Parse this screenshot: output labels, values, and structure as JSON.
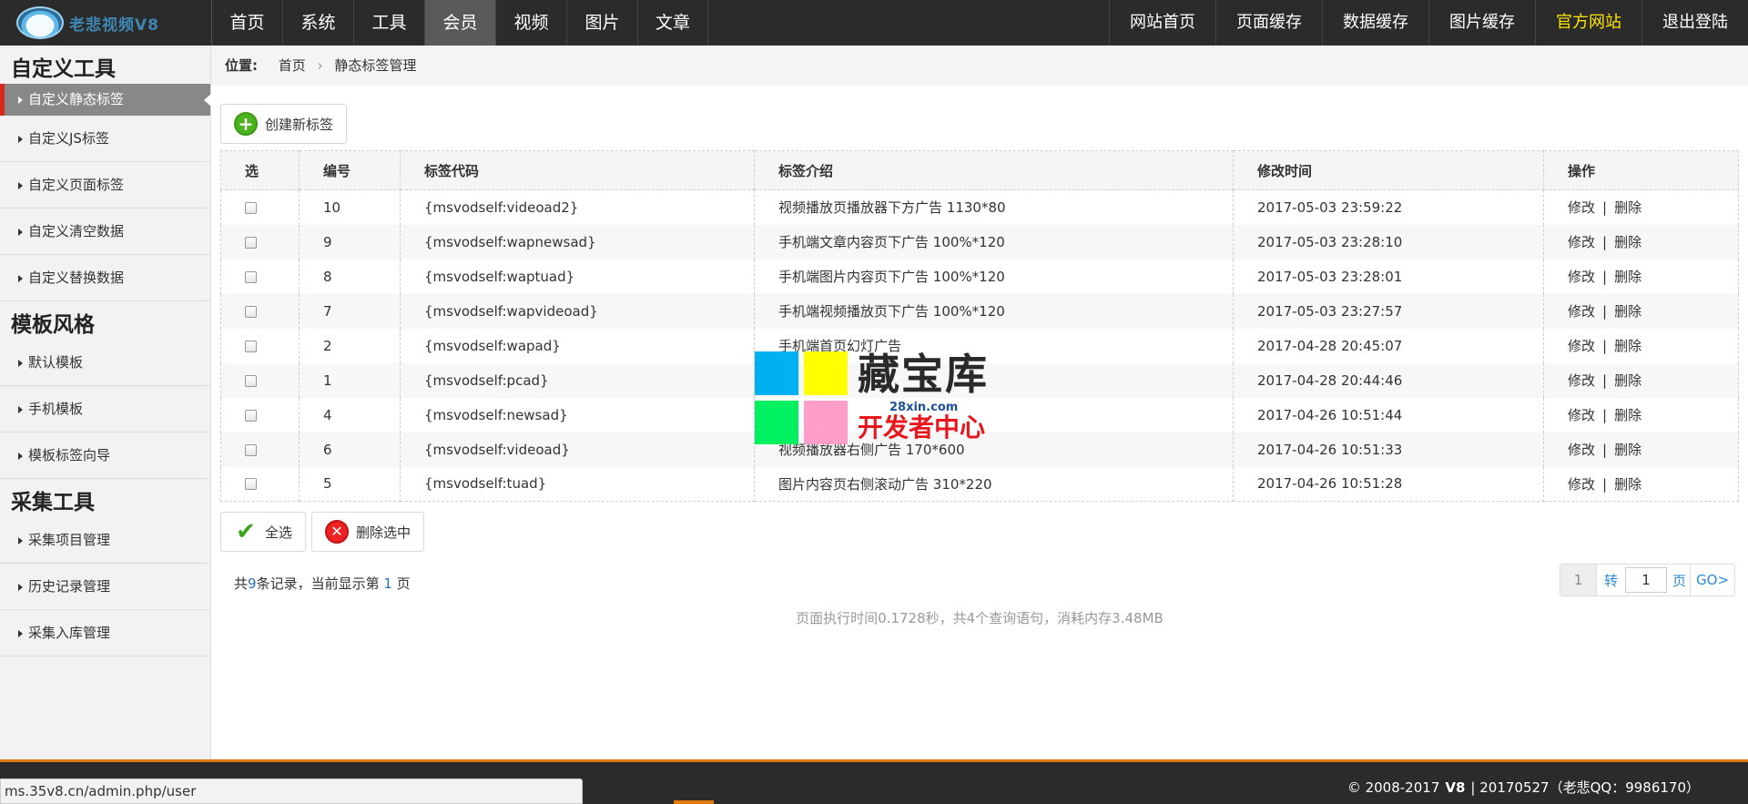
{
  "app": {
    "logo_text": "老悲视频V8"
  },
  "topnav": {
    "left": [
      {
        "label": "首页",
        "active": false
      },
      {
        "label": "系统",
        "active": false
      },
      {
        "label": "工具",
        "active": false
      },
      {
        "label": "会员",
        "active": true
      },
      {
        "label": "视频",
        "active": false
      },
      {
        "label": "图片",
        "active": false
      },
      {
        "label": "文章",
        "active": false
      }
    ],
    "right": [
      {
        "label": "网站首页"
      },
      {
        "label": "页面缓存"
      },
      {
        "label": "数据缓存"
      },
      {
        "label": "图片缓存"
      },
      {
        "label": "官方网站",
        "highlight": true
      },
      {
        "label": "退出登陆"
      }
    ]
  },
  "sidebar": {
    "groups": [
      {
        "title": "自定义工具",
        "items": [
          {
            "label": "自定义静态标签",
            "active": true
          },
          {
            "label": "自定义JS标签"
          },
          {
            "label": "自定义页面标签"
          },
          {
            "label": "自定义清空数据"
          },
          {
            "label": "自定义替换数据"
          }
        ]
      },
      {
        "title": "模板风格",
        "items": [
          {
            "label": "默认模板"
          },
          {
            "label": "手机模板"
          },
          {
            "label": "模板标签向导"
          }
        ]
      },
      {
        "title": "采集工具",
        "items": [
          {
            "label": "采集项目管理"
          },
          {
            "label": "历史记录管理"
          },
          {
            "label": "采集入库管理"
          }
        ]
      }
    ]
  },
  "breadcrumb": {
    "label": "位置:",
    "home": "首页",
    "sep": "›",
    "current": "静态标签管理"
  },
  "buttons": {
    "create": "创建新标签",
    "select_all": "全选",
    "delete_selected": "删除选中"
  },
  "table": {
    "headers": [
      "选",
      "编号",
      "标签代码",
      "标签介绍",
      "修改时间",
      "操作"
    ],
    "op_edit": "修改",
    "op_sep": "|",
    "op_delete": "删除",
    "rows": [
      {
        "id": "10",
        "code": "{msvodself:videoad2}",
        "desc": "视频播放页播放器下方广告 1130*80",
        "time": "2017-05-03 23:59:22"
      },
      {
        "id": "9",
        "code": "{msvodself:wapnewsad}",
        "desc": "手机端文章内容页下广告 100%*120",
        "time": "2017-05-03 23:28:10"
      },
      {
        "id": "8",
        "code": "{msvodself:waptuad}",
        "desc": "手机端图片内容页下广告 100%*120",
        "time": "2017-05-03 23:28:01"
      },
      {
        "id": "7",
        "code": "{msvodself:wapvideoad}",
        "desc": "手机端视频播放页下广告 100%*120",
        "time": "2017-05-03 23:27:57"
      },
      {
        "id": "2",
        "code": "{msvodself:wapad}",
        "desc": "手机端首页幻灯广告",
        "time": "2017-04-28 20:45:07"
      },
      {
        "id": "1",
        "code": "{msvodself:pcad}",
        "desc": "",
        "time": "2017-04-28 20:44:46"
      },
      {
        "id": "4",
        "code": "{msvodself:newsad}",
        "desc": "",
        "time": "2017-04-26 10:51:44"
      },
      {
        "id": "6",
        "code": "{msvodself:videoad}",
        "desc": "视频播放器右侧广告 170*600",
        "time": "2017-04-26 10:51:33"
      },
      {
        "id": "5",
        "code": "{msvodself:tuad}",
        "desc": "图片内容页右侧滚动广告 310*220",
        "time": "2017-04-26 10:51:28"
      }
    ]
  },
  "records": {
    "prefix": "共",
    "total": "9",
    "middle": "条记录，当前显示第 ",
    "page": "1",
    "suffix": " 页"
  },
  "pager": {
    "current": "1",
    "jump_label": "转",
    "input_value": "1",
    "unit": "页",
    "go": "GO>"
  },
  "exec_info": "页面执行时间0.1728秒，共4个查询语句，消耗内存3.48MB",
  "watermark": {
    "title": "藏宝库",
    "url": "28xin.com",
    "subtitle": "开发者中心",
    "colors": [
      "#00b0f0",
      "#ffff00",
      "#00f060",
      "#ff9ec8"
    ]
  },
  "status_url": "ms.35v8.cn/admin.php/user",
  "footer": {
    "copyright": "© 2008-2017",
    "version": "V8",
    "rest": "| 20170527（老悲QQ：9986170）"
  }
}
